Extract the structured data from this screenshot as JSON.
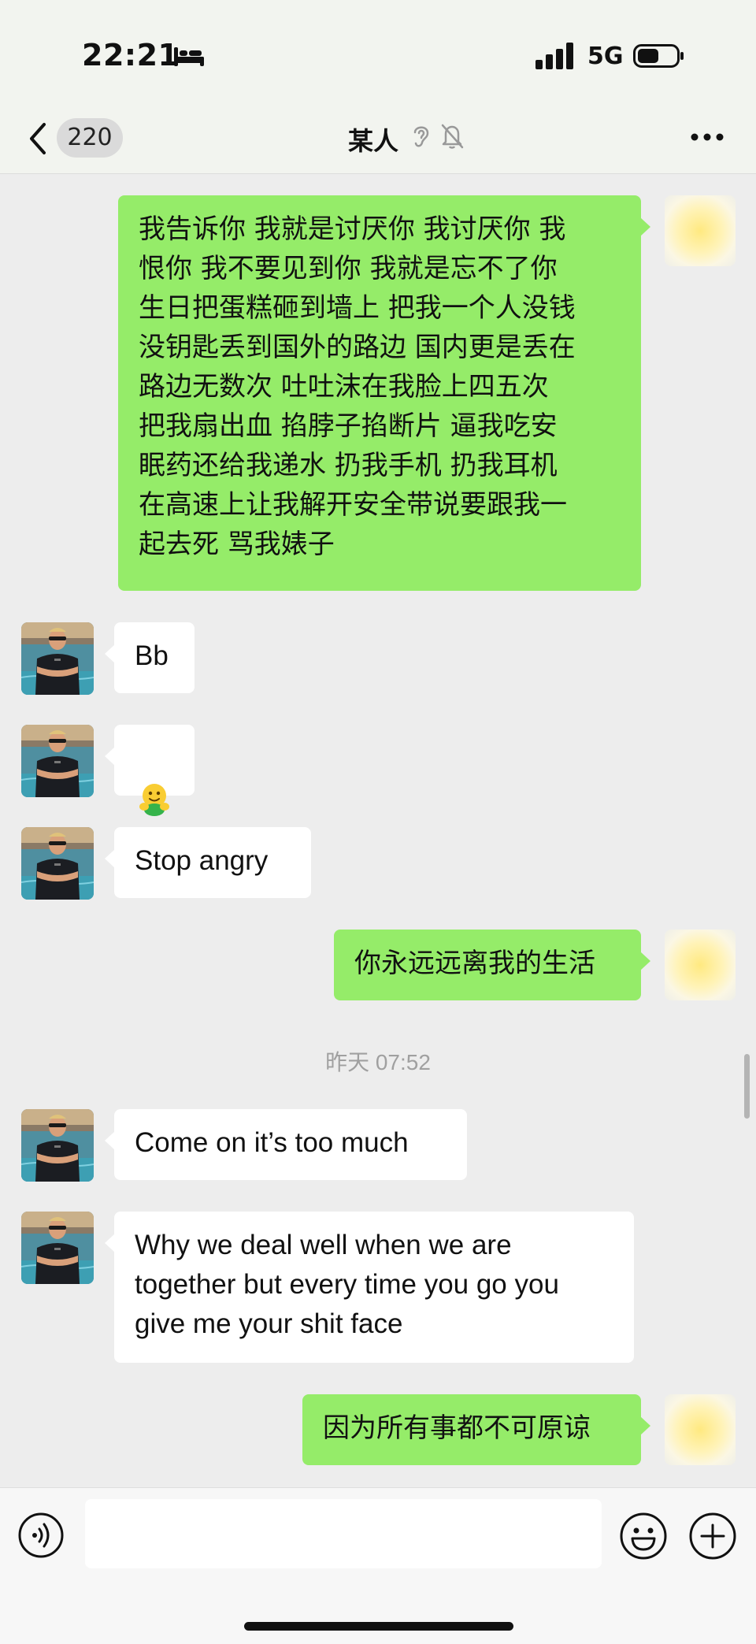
{
  "status_bar": {
    "time": "22:21",
    "network": "5G",
    "icons": [
      "bed-icon",
      "signal-icon",
      "battery-icon"
    ]
  },
  "nav": {
    "unread_count": "220",
    "contact_name": "某人",
    "icons": [
      "back-icon",
      "ear-icon",
      "mute-icon",
      "more-icon"
    ]
  },
  "messages": [
    {
      "sender": "self",
      "text": "我告诉你 我就是讨厌你 我讨厌你 我\n恨你 我不要见到你  我就是忘不了你\n生日把蛋糕砸到墙上 把我一个人没钱\n没钥匙丢到国外的路边 国内更是丢在\n路边无数次 吐吐沫在我脸上四五次\n把我扇出血 掐脖子掐断片 逼我吃安\n眠药还给我递水 扔我手机 扔我耳机\n在高速上让我解开安全带说要跟我一\n起去死 骂我婊子"
    },
    {
      "sender": "contact",
      "text": "Bb"
    },
    {
      "sender": "contact",
      "type": "emoji",
      "emoji": "hugging-face-emoji"
    },
    {
      "sender": "contact",
      "text": "Stop angry"
    },
    {
      "sender": "self",
      "text": "你永远远离我的生活"
    },
    {
      "sender": "contact",
      "text": "Come on it’s too much"
    },
    {
      "sender": "contact",
      "text": "Why we deal well when we are\ntogether but every time you go you\ngive me your shit face"
    },
    {
      "sender": "self",
      "text": "因为所有事都不可原谅"
    }
  ],
  "timestamp": "昨天 07:52",
  "input_bar": {
    "placeholder": "",
    "icons": [
      "voice-icon",
      "emoji-icon",
      "add-icon"
    ]
  },
  "colors": {
    "outgoing_bubble": "#95ec69",
    "incoming_bubble": "#ffffff",
    "chat_background": "#ededed"
  }
}
